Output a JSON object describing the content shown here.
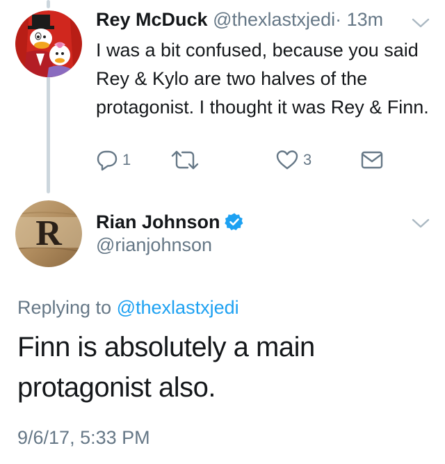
{
  "tweet1": {
    "name": "Rey McDuck",
    "handle": "@thexlastxjedi",
    "dot": "·",
    "time": "13m",
    "text": "I was a bit confused, because you said Rey & Kylo are two halves of the protagonist. I thought it was Rey & Finn.",
    "reply_count": "1",
    "retweet_count": "",
    "like_count": "3",
    "icons": {
      "reply": "reply-icon",
      "retweet": "retweet-icon",
      "like": "heart-icon",
      "dm": "envelope-icon",
      "menu": "chevron-down-icon"
    }
  },
  "tweet2": {
    "name": "Rian Johnson",
    "handle": "@rianjohnson",
    "verified": true,
    "replying_prefix": "Replying to",
    "replying_to": "@thexlastxjedi",
    "text": "Finn is absolutely a main protagonist also.",
    "timestamp": "9/6/17, 5:33 PM",
    "avatar_letter": "R"
  },
  "colors": {
    "primary_text": "#14171a",
    "secondary_text": "#657786",
    "link": "#1da1f2",
    "verified_badge": "#1da1f2",
    "thread_line": "#ccd6dd"
  }
}
